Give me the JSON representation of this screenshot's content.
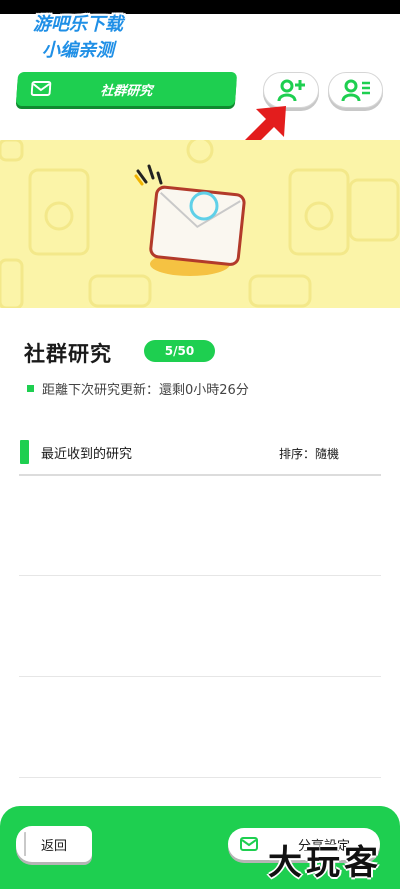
{
  "watermark": {
    "line1": "游吧乐下载",
    "line2": "小编亲测"
  },
  "tabs": {
    "research_label": "社群研究"
  },
  "header_icons": {
    "add_friend": "add-friend-icon",
    "friend_list": "friend-list-icon"
  },
  "page": {
    "title": "社群研究",
    "count": "5/50",
    "next_update": "距離下次研究更新：還剩0小時26分"
  },
  "section": {
    "title": "最近收到的研究",
    "sort": "排序：隨機"
  },
  "list": {
    "rows": [
      "",
      "",
      ""
    ]
  },
  "footer": {
    "back_label": "返回",
    "share_label": "分享設定"
  },
  "corner_watermark": "大玩客",
  "colors": {
    "accent": "#1ecf50",
    "banner": "#fbf4a8",
    "arrow": "#e31d1d"
  }
}
